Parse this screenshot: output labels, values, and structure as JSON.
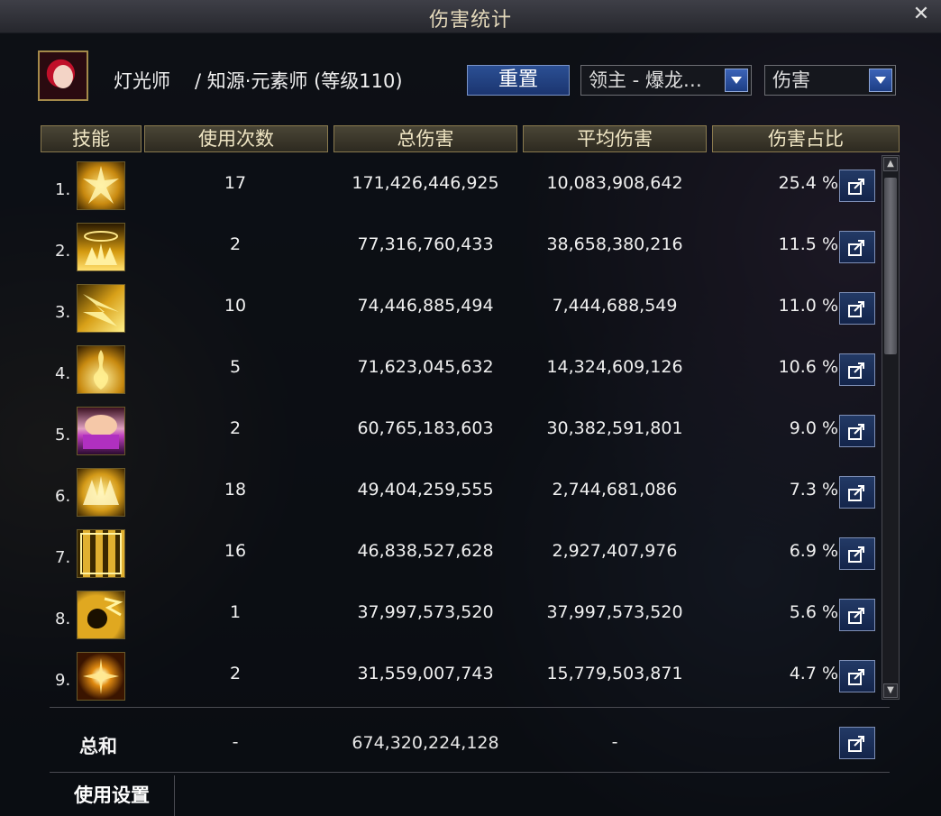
{
  "window": {
    "title": "伤害统计"
  },
  "character": {
    "name": "灯光师",
    "job": "/ 知源·元素师 (等级110)"
  },
  "controls": {
    "reset_label": "重置",
    "boss_selected": "领主 - 爆龙…",
    "metric_selected": "伤害"
  },
  "table": {
    "headers": [
      "技能",
      "使用次数",
      "总伤害",
      "平均伤害",
      "伤害占比"
    ],
    "rows": [
      {
        "rank": "1.",
        "count": "17",
        "total": "171,426,446,925",
        "avg": "10,083,908,642",
        "pct": "25.4 %"
      },
      {
        "rank": "2.",
        "count": "2",
        "total": "77,316,760,433",
        "avg": "38,658,380,216",
        "pct": "11.5 %"
      },
      {
        "rank": "3.",
        "count": "10",
        "total": "74,446,885,494",
        "avg": "7,444,688,549",
        "pct": "11.0 %"
      },
      {
        "rank": "4.",
        "count": "5",
        "total": "71,623,045,632",
        "avg": "14,324,609,126",
        "pct": "10.6 %"
      },
      {
        "rank": "5.",
        "count": "2",
        "total": "60,765,183,603",
        "avg": "30,382,591,801",
        "pct": "9.0 %"
      },
      {
        "rank": "6.",
        "count": "18",
        "total": "49,404,259,555",
        "avg": "2,744,681,086",
        "pct": "7.3 %"
      },
      {
        "rank": "7.",
        "count": "16",
        "total": "46,838,527,628",
        "avg": "2,927,407,976",
        "pct": "6.9 %"
      },
      {
        "rank": "8.",
        "count": "1",
        "total": "37,997,573,520",
        "avg": "37,997,573,520",
        "pct": "5.6 %"
      },
      {
        "rank": "9.",
        "count": "2",
        "total": "31,559,007,743",
        "avg": "15,779,503,871",
        "pct": "4.7 %"
      }
    ]
  },
  "totals": {
    "label": "总和",
    "count": "-",
    "total": "674,320,224,128",
    "avg": "-"
  },
  "footer": {
    "settings_tab": "使用设置"
  },
  "icons": {
    "close": "close-icon",
    "share": "share-icon",
    "skill": "skill-icon"
  },
  "colors": {
    "accent_gold": "#8a7a4e",
    "button_blue": "#2b4f93",
    "skill_gold": "#f0c030",
    "skill_purple": "#c040c0"
  }
}
